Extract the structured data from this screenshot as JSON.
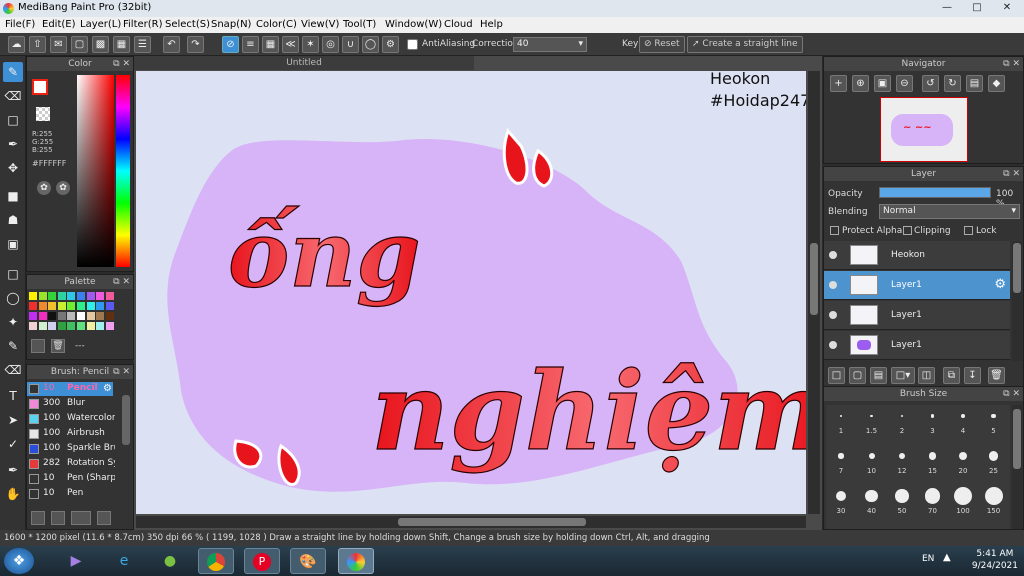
{
  "window": {
    "title": "MediBang Paint Pro (32bit)"
  },
  "menu": [
    "File(F)",
    "Edit(E)",
    "Layer(L)",
    "Filter(R)",
    "Select(S)",
    "Snap(N)",
    "Color(C)",
    "View(V)",
    "Tool(T)",
    "Window(W)",
    "Cloud",
    "Help"
  ],
  "toolbar": {
    "antialias_label": "AntiAliasing",
    "correction_label": "Correction",
    "correction_value": "40",
    "key_label": "Key",
    "reset_label": "Reset",
    "straight_label": "Create a straight line"
  },
  "canvas": {
    "tab_title": "Untitled",
    "watermark_line1": "Heokon",
    "watermark_line2": "#Hoidap247",
    "text_line1": "ống",
    "text_line2": "nghiệm"
  },
  "color_panel": {
    "title": "Color",
    "r": "R:255",
    "g": "G:255",
    "b": "B:255",
    "hex": "#FFFFFF"
  },
  "palette_panel": {
    "title": "Palette",
    "dashes": "---"
  },
  "brush_panel": {
    "title": "Brush: Pencil",
    "brushes": [
      {
        "size": "10",
        "name": "Pencil",
        "color": "#333333",
        "selected": true
      },
      {
        "size": "300",
        "name": "Blur",
        "color": "#f08ad8"
      },
      {
        "size": "100",
        "name": "Watercolor",
        "color": "#5ad2f0"
      },
      {
        "size": "100",
        "name": "Airbrush",
        "color": "#e6e6e6"
      },
      {
        "size": "100",
        "name": "Sparkle Brush",
        "color": "#2a4ed8"
      },
      {
        "size": "282",
        "name": "Rotation Sym",
        "color": "#e63a3a"
      },
      {
        "size": "10",
        "name": "Pen (Sharp)",
        "color": "#333333"
      },
      {
        "size": "10",
        "name": "Pen",
        "color": "#333333"
      }
    ]
  },
  "navigator": {
    "title": "Navigator"
  },
  "layer_panel": {
    "title": "Layer",
    "opacity_label": "Opacity",
    "opacity_value": "100 %",
    "opacity_fraction": 1.0,
    "blending_label": "Blending",
    "blending_value": "Normal",
    "protect_alpha": "Protect Alpha",
    "clipping": "Clipping",
    "lock": "Lock",
    "layers": [
      {
        "name": "Heokon",
        "selected": false
      },
      {
        "name": "Layer1",
        "selected": true
      },
      {
        "name": "Layer1",
        "selected": false
      },
      {
        "name": "Layer1",
        "selected": false
      }
    ]
  },
  "brush_size": {
    "title": "Brush Size",
    "sizes": [
      "1",
      "1.5",
      "2",
      "3",
      "4",
      "5",
      "7",
      "10",
      "12",
      "15",
      "20",
      "25",
      "30",
      "40",
      "50",
      "70",
      "100",
      "150"
    ]
  },
  "status": {
    "dimensions": "1600 * 1200 pixel",
    "physical": "(11.6 * 8.7cm)",
    "dpi": "350 dpi",
    "zoom": "66 %",
    "coords": "( 1199, 1028 )",
    "hint": "Draw a straight line by holding down Shift, Change a brush size by holding down Ctrl, Alt, and dragging"
  },
  "taskbar": {
    "lang": "EN",
    "time": "5:41 AM",
    "date": "9/24/2021"
  },
  "colors": {
    "accent": "#3d8fd6",
    "blob": "#d7b4f7",
    "text_red": "#e8141c",
    "canvas_bg": "#dde1f4"
  }
}
